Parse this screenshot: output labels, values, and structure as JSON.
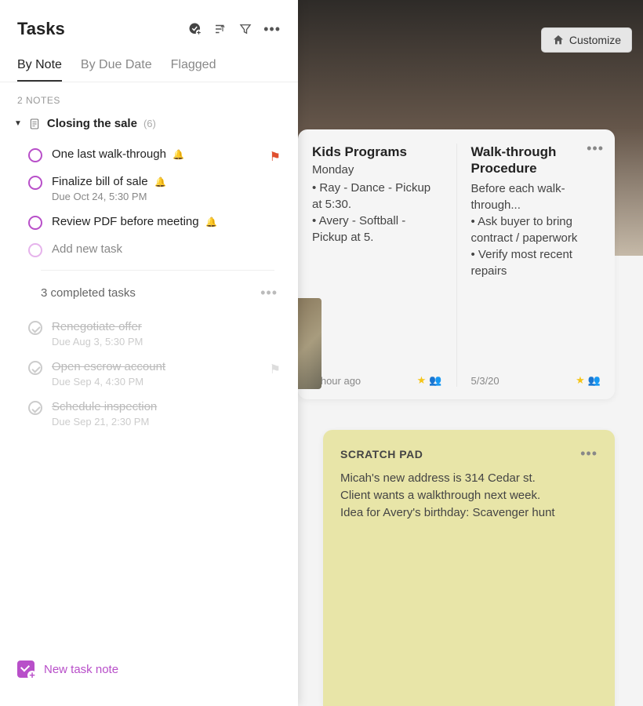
{
  "sidebar": {
    "title": "Tasks",
    "tabs": [
      "By Note",
      "By Due Date",
      "Flagged"
    ],
    "active_tab_index": 0,
    "notes_count_label": "2 NOTES",
    "group": {
      "name": "Closing the sale",
      "count": "(6)"
    },
    "tasks": [
      {
        "title": "One last walk-through",
        "due": "",
        "has_bell": true,
        "flagged": true,
        "completed": false
      },
      {
        "title": "Finalize bill of sale",
        "due": "Due Oct 24, 5:30 PM",
        "has_bell": true,
        "flagged": false,
        "completed": false
      },
      {
        "title": "Review PDF before meeting",
        "due": "",
        "has_bell": true,
        "flagged": false,
        "completed": false
      }
    ],
    "add_task_label": "Add new task",
    "completed_label": "3 completed tasks",
    "completed_tasks": [
      {
        "title": "Renegotiate offer",
        "due": "Due Aug 3, 5:30 PM",
        "flagged": false
      },
      {
        "title": "Open escrow account",
        "due": "Due Sep 4, 4:30 PM",
        "flagged": true
      },
      {
        "title": "Schedule inspection",
        "due": "Due Sep 21, 2:30 PM",
        "flagged": false
      }
    ],
    "footer_label": "New task note"
  },
  "customize_label": "Customize",
  "cards": [
    {
      "title": "Kids Programs",
      "sub": "Monday",
      "body": "• Ray - Dance - Pickup at 5:30.\n• Avery - Softball - Pickup at 5.",
      "time": "1 hour ago"
    },
    {
      "title": "Walk-through Procedure",
      "sub": "",
      "body": "Before each walk-through...\n• Ask buyer to bring contract / paperwork\n• Verify most recent repairs",
      "time": "5/3/20"
    }
  ],
  "scratch": {
    "title": "SCRATCH PAD",
    "body": "Micah's new address is 314 Cedar st.\nClient wants a walkthrough next week.\nIdea for Avery's birthday: Scavenger hunt"
  }
}
